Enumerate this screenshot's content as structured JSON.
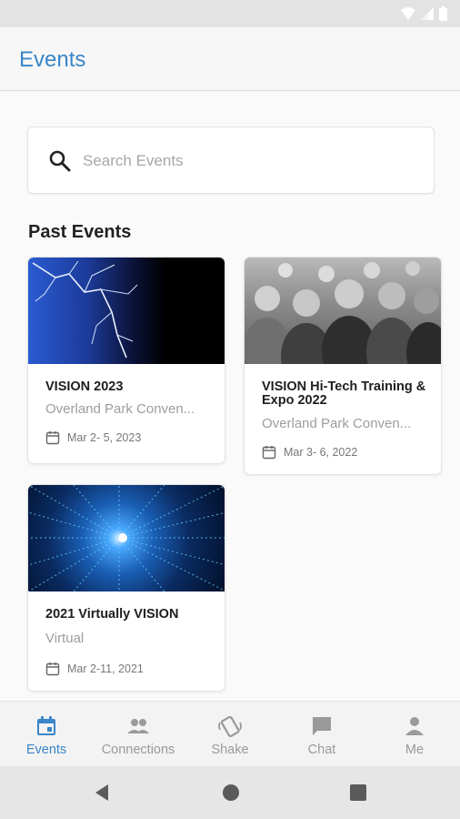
{
  "app": {
    "title": "Events"
  },
  "search": {
    "placeholder": "Search Events",
    "value": ""
  },
  "section": {
    "title": "Past Events"
  },
  "events": [
    {
      "title": "VISION 2023",
      "venue": "Overland Park Conven...",
      "date": "Mar  2- 5, 2023",
      "image": "lightning-image"
    },
    {
      "title": "VISION Hi-Tech Training & Expo 2022",
      "venue": "Overland Park Conven...",
      "date": "Mar  3- 6, 2022",
      "image": "crowd-photo"
    },
    {
      "title": "2021 Virtually VISION",
      "venue": "Virtual",
      "date": "Mar  2-11, 2021",
      "image": "data-tunnel-image"
    }
  ],
  "nav": {
    "items": [
      {
        "label": "Events",
        "icon": "calendar-icon",
        "active": true
      },
      {
        "label": "Connections",
        "icon": "people-icon",
        "active": false
      },
      {
        "label": "Shake",
        "icon": "shake-phone-icon",
        "active": false
      },
      {
        "label": "Chat",
        "icon": "chat-bubble-icon",
        "active": false
      },
      {
        "label": "Me",
        "icon": "person-icon",
        "active": false
      }
    ]
  },
  "colors": {
    "accent": "#3a86c8",
    "inactive": "#9a9a9a"
  }
}
